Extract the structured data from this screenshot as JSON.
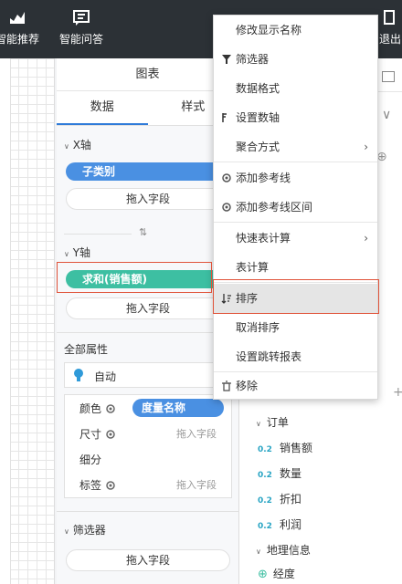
{
  "topbar": {
    "items": [
      {
        "label": "智能推荐",
        "icon": "chart-icon"
      },
      {
        "label": "智能问答",
        "icon": "chat-icon"
      },
      {
        "label": "退出",
        "icon": "exit-icon"
      }
    ]
  },
  "panel": {
    "title": "图表",
    "tabs": [
      "数据",
      "样式"
    ],
    "x_axis": {
      "title": "X轴",
      "field": "子类别",
      "drop": "拖入字段"
    },
    "swap_icon": "swap-icon",
    "y_axis": {
      "title": "Y轴",
      "field": "求和(销售额)",
      "drop": "拖入字段"
    },
    "all_props": {
      "title": "全部属性",
      "chart_type": "自动",
      "rows": [
        {
          "label": "颜色",
          "value": "度量名称",
          "is_pill": true
        },
        {
          "label": "尺寸",
          "value": "拖入字段",
          "is_pill": false
        },
        {
          "label": "细分",
          "value": "",
          "is_pill": false
        },
        {
          "label": "标签",
          "value": "拖入字段",
          "is_pill": false
        }
      ]
    },
    "filter": {
      "title": "筛选器",
      "drop": "拖入字段"
    }
  },
  "tree": {
    "items": [
      {
        "label": "订单",
        "type": "group"
      },
      {
        "label": "销售额",
        "type": "measure",
        "badge": "0.2"
      },
      {
        "label": "数量",
        "type": "measure",
        "badge": "0.2"
      },
      {
        "label": "折扣",
        "type": "measure",
        "badge": "0.2"
      },
      {
        "label": "利润",
        "type": "measure",
        "badge": "0.2"
      },
      {
        "label": "地理信息",
        "type": "group"
      },
      {
        "label": "经度",
        "type": "geo"
      }
    ]
  },
  "context_menu": {
    "items": [
      {
        "label": "修改显示名称",
        "icon": ""
      },
      {
        "label": "筛选器",
        "icon": "filter-icon"
      },
      {
        "label": "数据格式",
        "icon": ""
      },
      {
        "label": "设置数轴",
        "icon": "axis-icon"
      },
      {
        "label": "聚合方式",
        "icon": "",
        "submenu": true
      },
      {
        "label": "添加参考线",
        "icon": "gear-icon"
      },
      {
        "label": "添加参考线区间",
        "icon": "gear-icon"
      },
      {
        "label": "快速表计算",
        "icon": "",
        "submenu": true
      },
      {
        "label": "表计算",
        "icon": ""
      },
      {
        "label": "排序",
        "icon": "sort-icon",
        "highlighted": true
      },
      {
        "label": "取消排序",
        "icon": ""
      },
      {
        "label": "设置跳转报表",
        "icon": ""
      },
      {
        "label": "移除",
        "icon": "trash-icon"
      }
    ]
  },
  "colors": {
    "dimension_pill": "#4a90e2",
    "measure_pill": "#3dbfa2",
    "highlight_border": "#e0533a",
    "accent": "#2f7bd9"
  }
}
